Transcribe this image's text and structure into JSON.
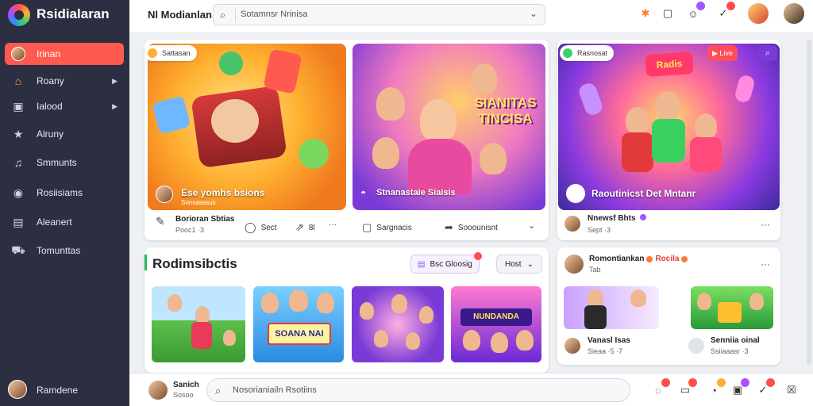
{
  "app": {
    "title": "Rsidialaran"
  },
  "sidebar": {
    "items": [
      {
        "label": "Irinan",
        "icon": "user-icon",
        "active": true
      },
      {
        "label": "Roany",
        "icon": "home-icon",
        "chevron": true
      },
      {
        "label": "Ialood",
        "icon": "library-icon",
        "chevron": true
      },
      {
        "label": "Alruny",
        "icon": "star-icon"
      },
      {
        "label": "Smmunts",
        "icon": "bell-icon"
      },
      {
        "label": "Rosiisiams",
        "icon": "disc-icon"
      },
      {
        "label": "Aleanert",
        "icon": "window-icon"
      },
      {
        "label": "Tomunttas",
        "icon": "bus-icon"
      }
    ],
    "user": {
      "name": "Ramdene"
    }
  },
  "topbar": {
    "title": "Nl Modianlan",
    "search_placeholder": "Sotamnsr Nrinisa",
    "badge_colors": [
      "#9b59ff",
      "#ff4d4d"
    ]
  },
  "feature_cards": [
    {
      "chip": "Sattasan",
      "caption": "Ese yomhs bsions",
      "subcaption": "Sonsasasus",
      "author": "Borioran Sbtias",
      "meta": "Pooc1 ·3",
      "actions": [
        "Sect",
        "8l",
        "···"
      ]
    },
    {
      "caption": "Stnanastaie Siaisis",
      "title_art": "SIANITAS TINCISA",
      "actions": [
        "Sargnacis",
        "Sooounisnt"
      ]
    },
    {
      "chip": "Rasnosat",
      "title_art": "Radis",
      "live_label": "Live",
      "caption": "Raoutinicst Det Mntanr",
      "author": "Nnewsf Bhts",
      "meta": "Sept ·3"
    }
  ],
  "recommended": {
    "title": "Rodimsibctis",
    "filter_button": "Bsc Gloosig",
    "sort": "Host",
    "thumbs": [
      "park",
      "SOANA NAI",
      "group",
      "NUNDANDA"
    ]
  },
  "side_post": {
    "author": "Romontiankan",
    "tag": "Rocila",
    "time": "Tab",
    "items": [
      {
        "name": "Vanasl Isas",
        "meta": "Sieaa ·5 ·7"
      },
      {
        "name": "Senniia oinal",
        "meta": "Ssiiaaasr ·3"
      }
    ]
  },
  "bottom_bar": {
    "user": "Sanich",
    "sub": "Sosoo",
    "compose_placeholder": "Nosorianiailn Rsotiins",
    "icon_badges": [
      "#ff4d4d",
      "#ff4d4d",
      "#ffb02e",
      "#b14dff",
      "#ff4d4d"
    ]
  }
}
